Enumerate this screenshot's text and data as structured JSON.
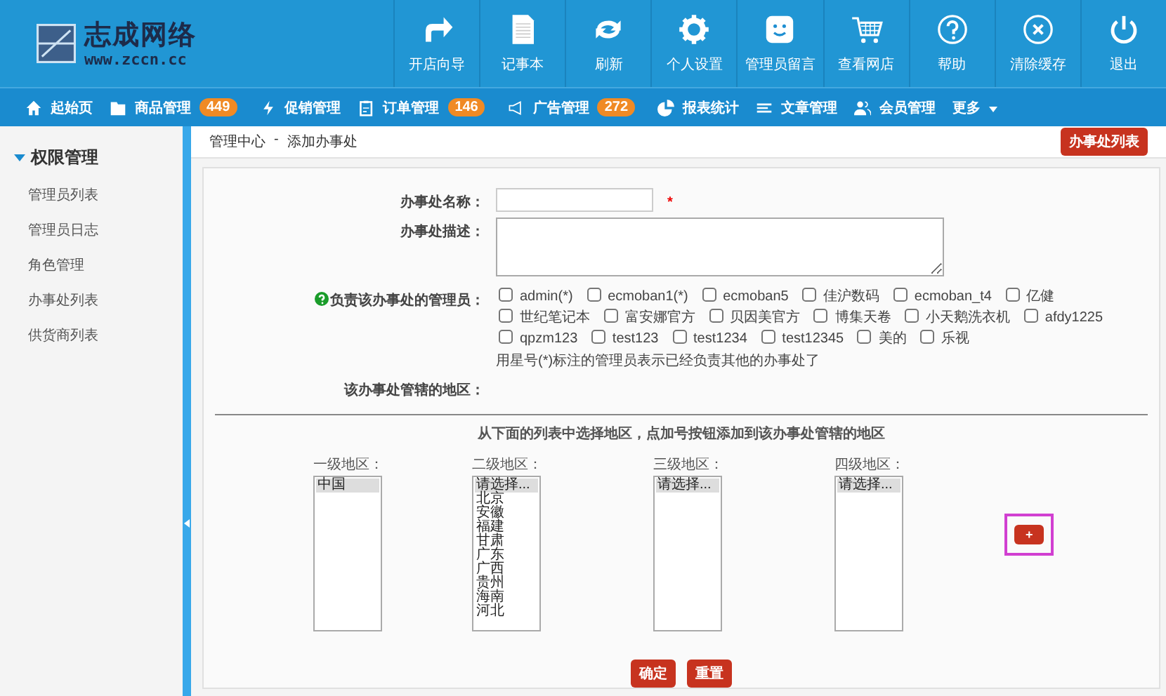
{
  "header": {
    "logo": {
      "name": "志成网络",
      "url": "www.zccn.cc"
    },
    "toolbar": [
      {
        "kind": "arrow",
        "label": "开店向导"
      },
      {
        "kind": "document",
        "label": "记事本"
      },
      {
        "kind": "refresh",
        "label": "刷新"
      },
      {
        "kind": "gear",
        "label": "个人设置"
      },
      {
        "kind": "smiley",
        "label": "管理员留言"
      },
      {
        "kind": "cart",
        "label": "查看网店"
      },
      {
        "kind": "question",
        "label": "帮助"
      },
      {
        "kind": "close",
        "label": "清除缓存"
      },
      {
        "kind": "power",
        "label": "退出"
      }
    ]
  },
  "nav": [
    {
      "kind": "home",
      "label": "起始页"
    },
    {
      "kind": "folder",
      "label": "商品管理",
      "badge": "449"
    },
    {
      "kind": "bolt",
      "label": "促销管理"
    },
    {
      "kind": "clipboard",
      "label": "订单管理",
      "badge": "146"
    },
    {
      "kind": "megaphone",
      "label": "广告管理",
      "badge": "272"
    },
    {
      "kind": "pie",
      "label": "报表统计"
    },
    {
      "kind": "lines",
      "label": "文章管理"
    },
    {
      "kind": "users",
      "label": "会员管理"
    },
    {
      "kind": "dropdown",
      "label": "更多"
    }
  ],
  "sidebar": {
    "title": "权限管理",
    "expanded": true,
    "items": [
      {
        "label": "管理员列表"
      },
      {
        "label": "管理员日志"
      },
      {
        "label": "角色管理"
      },
      {
        "label": "办事处列表"
      },
      {
        "label": "供货商列表"
      }
    ]
  },
  "breadcrumb": {
    "items": [
      "管理中心",
      "添加办事处"
    ],
    "separator": "-"
  },
  "action_button": "办事处列表",
  "form": {
    "name_label": "办事处名称：",
    "required_mark": "*",
    "description_label": "办事处描述：",
    "managers_label": "负责该办事处的管理员：",
    "managers": [
      {
        "label": "admin(*)",
        "checked": false
      },
      {
        "label": "ecmoban1(*)",
        "checked": false
      },
      {
        "label": "ecmoban5",
        "checked": false
      },
      {
        "label": "佳沪数码",
        "checked": false
      },
      {
        "label": "ecmoban_t4",
        "checked": false
      },
      {
        "label": "亿健",
        "checked": false
      },
      {
        "label": "世纪笔记本",
        "checked": false
      },
      {
        "label": "富安娜官方",
        "checked": false
      },
      {
        "label": "贝因美官方",
        "checked": false
      },
      {
        "label": "博集天卷",
        "checked": false
      },
      {
        "label": "小天鹅洗衣机",
        "checked": false
      },
      {
        "label": "afdy1225",
        "checked": false
      },
      {
        "label": "qpzm123",
        "checked": false
      },
      {
        "label": "test123",
        "checked": false
      },
      {
        "label": "test1234",
        "checked": false
      },
      {
        "label": "test12345",
        "checked": false
      },
      {
        "label": "美的",
        "checked": false
      },
      {
        "label": "乐视",
        "checked": false
      }
    ],
    "managers_hint": "用星号(*)标注的管理员表示已经负责其他的办事处了",
    "regions_label": "该办事处管辖的地区：",
    "instruction": "从下面的列表中选择地区，点加号按钮添加到该办事处管辖的地区",
    "regions": [
      {
        "label": "一级地区：",
        "options": [
          {
            "text": "中国",
            "selected": true
          }
        ]
      },
      {
        "label": "二级地区：",
        "options": [
          {
            "text": "请选择...",
            "selected": true
          },
          {
            "text": "北京",
            "selected": false
          },
          {
            "text": "安徽",
            "selected": false
          },
          {
            "text": "福建",
            "selected": false
          },
          {
            "text": "甘肃",
            "selected": false
          },
          {
            "text": "广东",
            "selected": false
          },
          {
            "text": "广西",
            "selected": false
          },
          {
            "text": "贵州",
            "selected": false
          },
          {
            "text": "海南",
            "selected": false
          },
          {
            "text": "河北",
            "selected": false
          }
        ]
      },
      {
        "label": "三级地区：",
        "options": [
          {
            "text": "请选择...",
            "selected": true
          }
        ]
      },
      {
        "label": "四级地区：",
        "options": [
          {
            "text": "请选择...",
            "selected": true
          }
        ]
      }
    ],
    "add_button": "+",
    "buttons": [
      "确定",
      "重置"
    ]
  }
}
